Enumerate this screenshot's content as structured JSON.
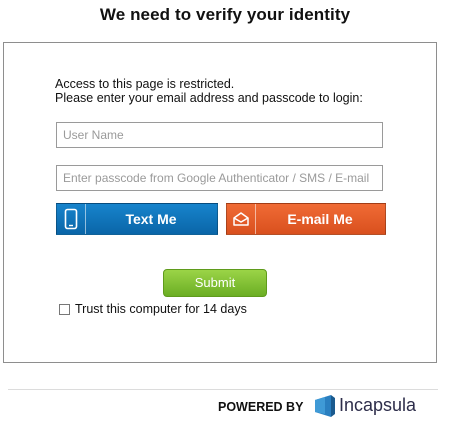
{
  "page": {
    "title": "We need to verify your identity"
  },
  "form": {
    "message_line1": "Access to this page is restricted.",
    "message_line2": "Please enter your email address and passcode to login:",
    "username_placeholder": "User Name",
    "passcode_placeholder": "Enter passcode from Google Authenticator / SMS / E-mail",
    "text_me_label": "Text Me",
    "text_me_icon": "phone-icon",
    "email_me_label": "E-mail Me",
    "email_me_icon": "envelope-icon",
    "submit_label": "Submit",
    "trust_label": "Trust this computer for 14 days",
    "trust_checked": false
  },
  "footer": {
    "powered_by": "POWERED BY",
    "brand": "Incapsula",
    "logo_icon": "incapsula-logo-icon"
  },
  "colors": {
    "text_me_button": "#0f75bc",
    "email_me_button": "#e85d27",
    "submit_button": "#7cbf2f",
    "brand_blue": "#2a7fc0"
  }
}
